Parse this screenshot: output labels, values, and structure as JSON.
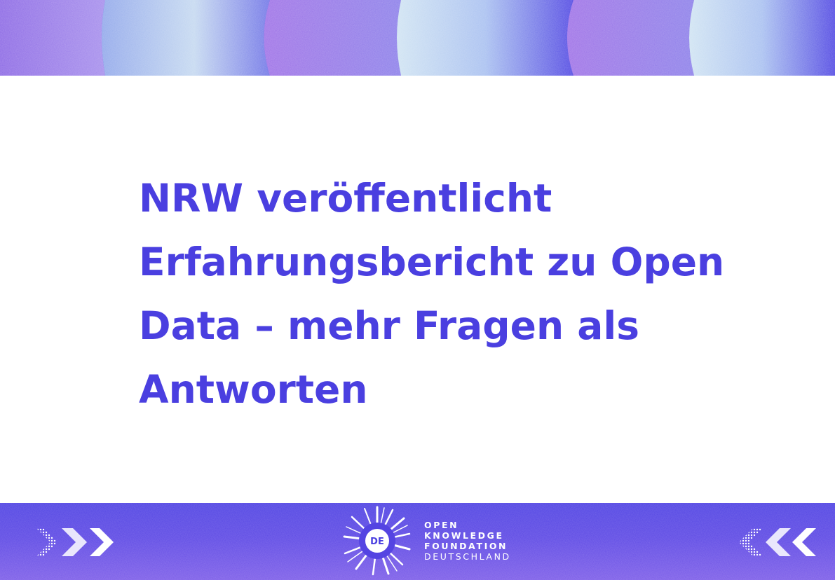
{
  "headline": "NRW veröffentlicht Erfahrungsbericht zu Open Data – mehr Fragen als Antworten",
  "brand": {
    "badge": "DE",
    "line1": "OPEN",
    "line2": "KNOWLEDGE",
    "line3": "FOUNDATION",
    "line4": "DEUTSCHLAND"
  },
  "colors": {
    "headline": "#4a3fe0",
    "band_blue": "#4c3fe2",
    "band_violet": "#9a6fe6",
    "band_light": "#c9dcf0",
    "background": "#ffffff"
  },
  "icons": {
    "left": "chevrons-right-icon",
    "right": "chevrons-left-icon",
    "logo": "sunburst-logo-icon"
  }
}
